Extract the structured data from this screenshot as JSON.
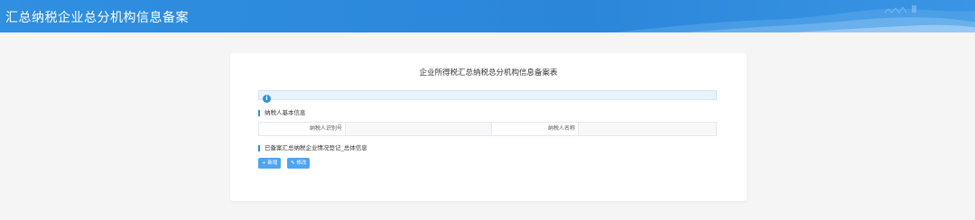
{
  "header": {
    "title": "汇总纳税企业总分机构信息备案"
  },
  "form": {
    "title": "企业所得税汇总纳税总分机构信息备案表",
    "notice_icon": "info-icon",
    "section1": {
      "label": "纳税人基本信息"
    },
    "fields": [
      {
        "label": "纳税人识别号",
        "value": ""
      },
      {
        "label": "纳税人名称",
        "value": ""
      }
    ],
    "section2": {
      "label": "已备案汇总纳税企业情况登记_总体信息"
    },
    "buttons": {
      "add": {
        "icon": "plus-icon",
        "label": "新增"
      },
      "edit": {
        "icon": "edit-icon",
        "label": "修改"
      }
    }
  },
  "colors": {
    "header": "#2f8fe0",
    "button": "#4ea4ef",
    "background": "#f5f5f6"
  }
}
